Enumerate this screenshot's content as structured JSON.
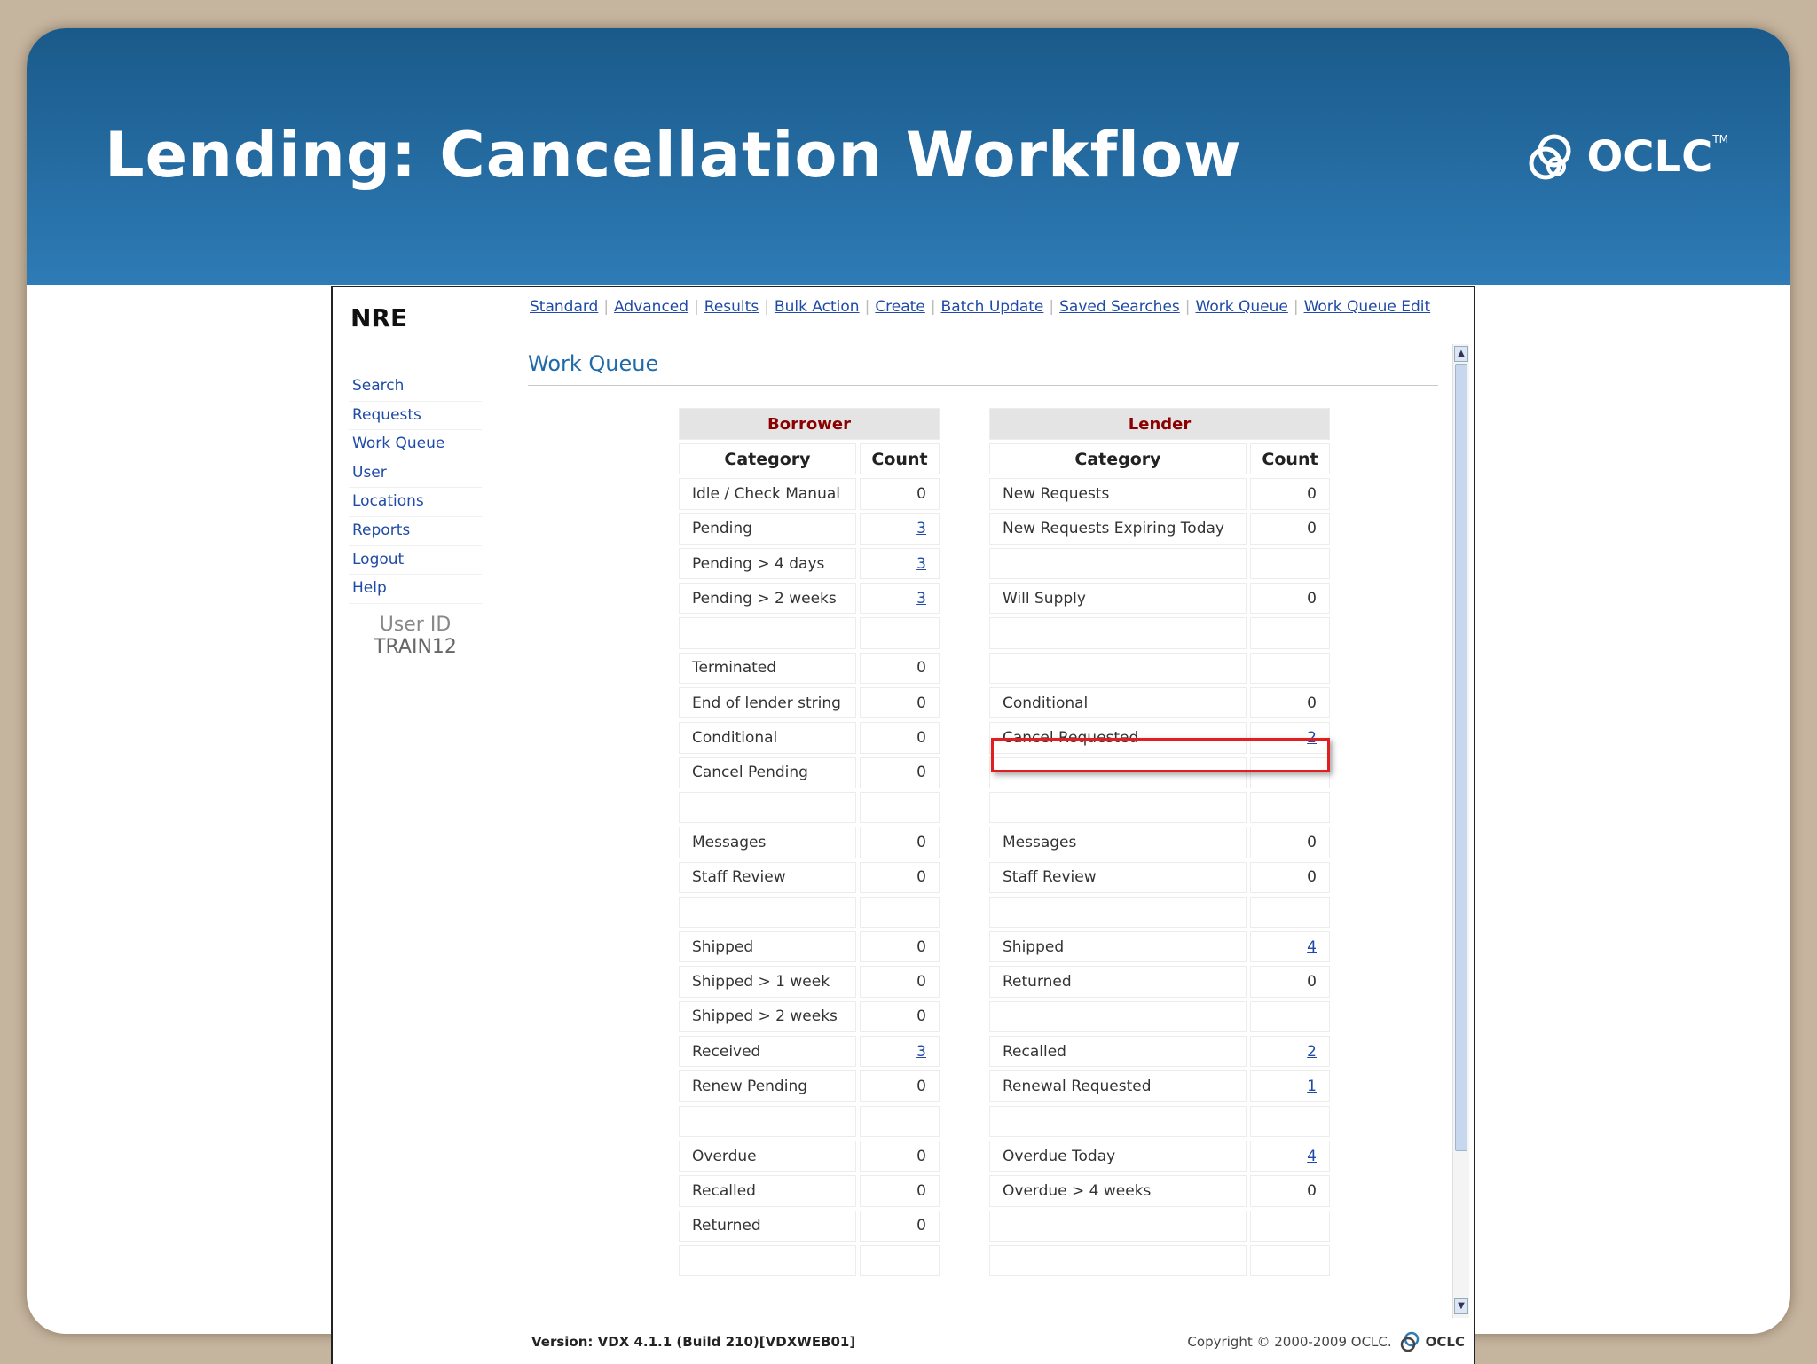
{
  "slide": {
    "title": "Lending: Cancellation Workflow",
    "logo_text": "OCLC",
    "logo_tm": "TM"
  },
  "app": {
    "brand": "NRE",
    "top_nav": [
      "Standard",
      "Advanced",
      "Results",
      "Bulk Action",
      "Create",
      "Batch Update",
      "Saved Searches",
      "Work Queue",
      "Work Queue Edit"
    ],
    "left_nav": [
      "Search",
      "Requests",
      "Work Queue",
      "User",
      "Locations",
      "Reports",
      "Logout",
      "Help"
    ],
    "user_id_label": "User ID",
    "user_id_value": "TRAIN12",
    "page_title": "Work Queue"
  },
  "borrower": {
    "title": "Borrower",
    "col_category": "Category",
    "col_count": "Count",
    "rows": [
      {
        "cat": "Idle / Check Manual",
        "count": "0",
        "link": false
      },
      {
        "cat": "Pending",
        "count": "3",
        "link": true
      },
      {
        "cat": "Pending > 4 days",
        "count": "3",
        "link": true
      },
      {
        "cat": "Pending > 2 weeks",
        "count": "3",
        "link": true
      },
      {
        "cat": "",
        "count": "",
        "link": false
      },
      {
        "cat": "Terminated",
        "count": "0",
        "link": false
      },
      {
        "cat": "End of lender string",
        "count": "0",
        "link": false
      },
      {
        "cat": "Conditional",
        "count": "0",
        "link": false
      },
      {
        "cat": "Cancel Pending",
        "count": "0",
        "link": false
      },
      {
        "cat": "",
        "count": "",
        "link": false
      },
      {
        "cat": "Messages",
        "count": "0",
        "link": false
      },
      {
        "cat": "Staff Review",
        "count": "0",
        "link": false
      },
      {
        "cat": "",
        "count": "",
        "link": false
      },
      {
        "cat": "Shipped",
        "count": "0",
        "link": false
      },
      {
        "cat": "Shipped > 1 week",
        "count": "0",
        "link": false
      },
      {
        "cat": "Shipped > 2 weeks",
        "count": "0",
        "link": false
      },
      {
        "cat": "Received",
        "count": "3",
        "link": true
      },
      {
        "cat": "Renew Pending",
        "count": "0",
        "link": false
      },
      {
        "cat": "",
        "count": "",
        "link": false
      },
      {
        "cat": "Overdue",
        "count": "0",
        "link": false
      },
      {
        "cat": "Recalled",
        "count": "0",
        "link": false
      },
      {
        "cat": "Returned",
        "count": "0",
        "link": false
      },
      {
        "cat": "",
        "count": "",
        "link": false
      }
    ]
  },
  "lender": {
    "title": "Lender",
    "col_category": "Category",
    "col_count": "Count",
    "rows": [
      {
        "cat": "New Requests",
        "count": "0",
        "link": false
      },
      {
        "cat": "New Requests Expiring Today",
        "count": "0",
        "link": false
      },
      {
        "cat": "",
        "count": "",
        "link": false
      },
      {
        "cat": "Will Supply",
        "count": "0",
        "link": false
      },
      {
        "cat": "",
        "count": "",
        "link": false
      },
      {
        "cat": "",
        "count": "",
        "link": false
      },
      {
        "cat": "Conditional",
        "count": "0",
        "link": false
      },
      {
        "cat": "Cancel Requested",
        "count": "2",
        "link": true
      },
      {
        "cat": "",
        "count": "",
        "link": false
      },
      {
        "cat": "",
        "count": "",
        "link": false
      },
      {
        "cat": "Messages",
        "count": "0",
        "link": false
      },
      {
        "cat": "Staff Review",
        "count": "0",
        "link": false
      },
      {
        "cat": "",
        "count": "",
        "link": false
      },
      {
        "cat": "Shipped",
        "count": "4",
        "link": true
      },
      {
        "cat": "Returned",
        "count": "0",
        "link": false
      },
      {
        "cat": "",
        "count": "",
        "link": false
      },
      {
        "cat": "Recalled",
        "count": "2",
        "link": true
      },
      {
        "cat": "Renewal Requested",
        "count": "1",
        "link": true
      },
      {
        "cat": "",
        "count": "",
        "link": false
      },
      {
        "cat": "Overdue Today",
        "count": "4",
        "link": true
      },
      {
        "cat": "Overdue > 4 weeks",
        "count": "0",
        "link": false
      },
      {
        "cat": "",
        "count": "",
        "link": false
      },
      {
        "cat": "",
        "count": "",
        "link": false
      }
    ]
  },
  "footer": {
    "version": "Version: VDX 4.1.1 (Build 210)[VDXWEB01]",
    "copyright": "Copyright © 2000-2009 OCLC.",
    "logo_text": "OCLC"
  },
  "colors": {
    "banner_top": "#1a5a8a",
    "banner_bottom": "#2e7bb6",
    "link": "#1f4aa8",
    "table_header_text": "#8b0000",
    "highlight_box": "#e02020"
  }
}
